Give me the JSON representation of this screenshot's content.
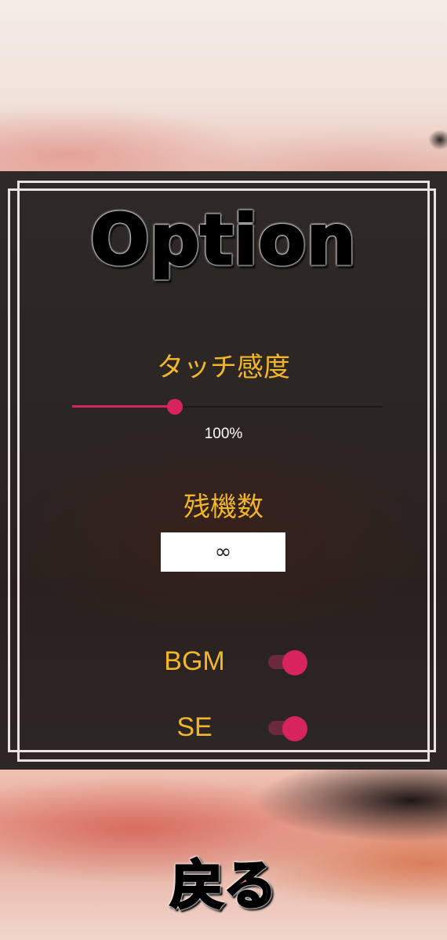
{
  "title": "Option",
  "touch_sensitivity": {
    "label": "タッチ感度",
    "value_fraction": 0.33,
    "percent_text": "100%",
    "accent_color": "#d7245f"
  },
  "lives": {
    "label": "残機数",
    "value": "∞"
  },
  "toggles": [
    {
      "label": "BGM",
      "on": true
    },
    {
      "label": "SE",
      "on": true
    }
  ],
  "back_button": "戻る",
  "colors": {
    "label_color": "#f2b52e",
    "panel_bg": "#2b2523",
    "frame": "#e9e4e2"
  }
}
